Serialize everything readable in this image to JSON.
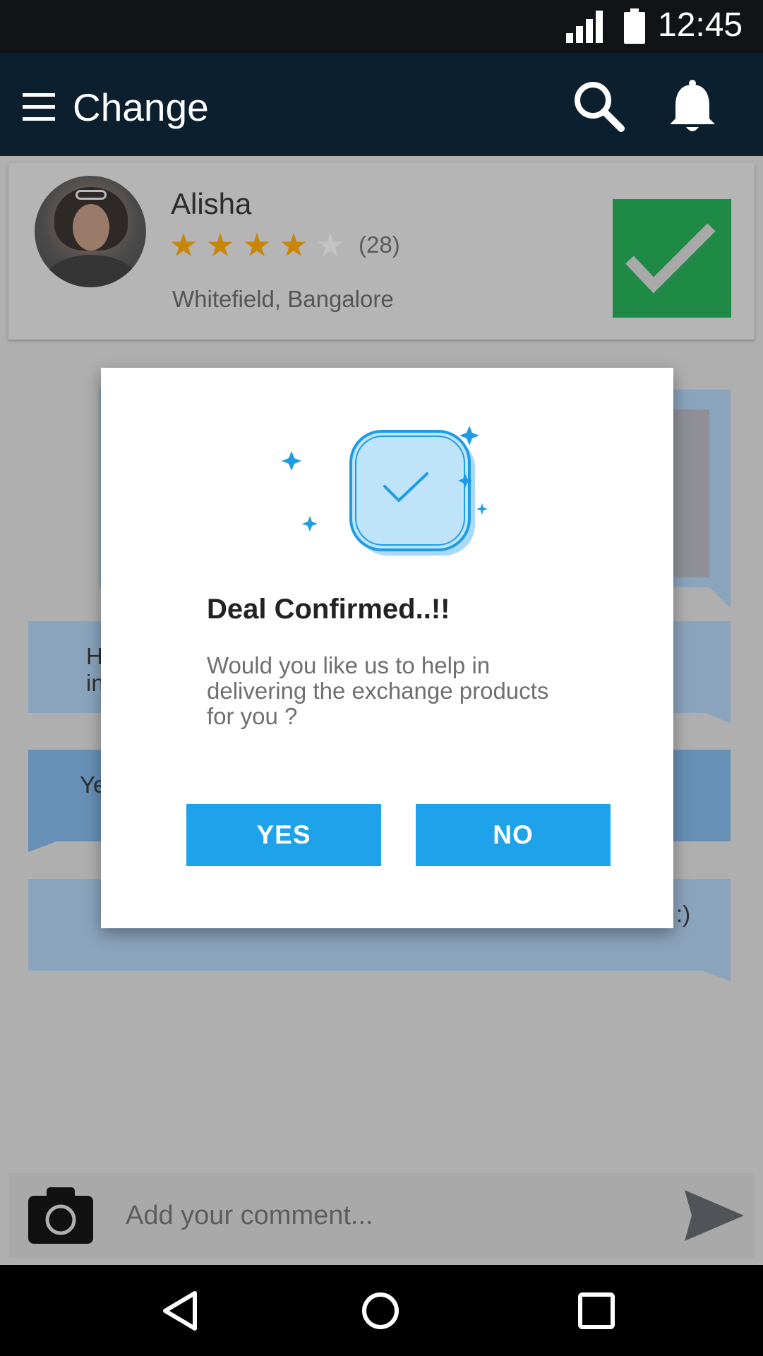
{
  "status_bar": {
    "time": "12:45"
  },
  "app_bar": {
    "title": "Change"
  },
  "profile": {
    "name": "Alisha",
    "rating": 4,
    "rating_max": 5,
    "rating_count": "(28)",
    "location": "Whitefield, Bangalore"
  },
  "chat": {
    "bubble_2_partial": "H",
    "bubble_2_partial_line2": "in",
    "bubble_3_partial": "Ye",
    "bubble_4_partial": ":)"
  },
  "comment": {
    "placeholder": "Add your comment..."
  },
  "dialog": {
    "title": "Deal Confirmed..!!",
    "message": "Would you like us to help in delivering the exchange products for you ?",
    "yes_label": "YES",
    "no_label": "NO"
  },
  "colors": {
    "app_bar": "#0c1f2e",
    "accent": "#1ea3ea",
    "confirm_green": "#1f8a45",
    "star": "#c7850a"
  },
  "icons": [
    "signal-icon",
    "battery-icon",
    "menu-icon",
    "search-icon",
    "bell-icon",
    "check-icon",
    "camera-icon",
    "send-icon",
    "nav-back-icon",
    "nav-home-icon",
    "nav-recents-icon"
  ]
}
